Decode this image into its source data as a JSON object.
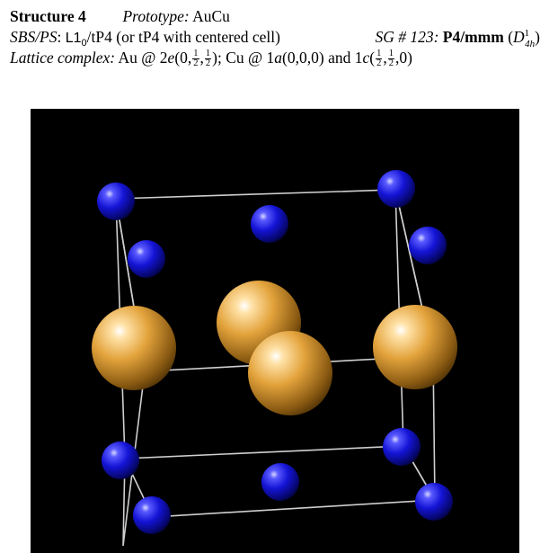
{
  "header": {
    "structure_label": "Structure 4",
    "prototype_label": "Prototype:",
    "prototype_value": "AuCu",
    "sbs_label": "SBS/PS",
    "sbs_value_pre": "L1",
    "sbs_value_sub": "0",
    "sbs_value_post": "/tP4 (or tP4 with centered cell)",
    "sg_label": "SG # 123:",
    "sg_value": "P4/mmm",
    "sg_schoenflies": "D",
    "sg_schoenflies_sup": "1",
    "sg_schoenflies_sub": "4h",
    "lattice_label": "Lattice complex:",
    "au_site_text": "Au @ 2",
    "au_wyckoff": "e",
    "half": "1",
    "two": "2",
    "zero": "0",
    "cu_site_text": "Cu @ 1",
    "cu_wyckoff_a": "a",
    "cu_coords_a": "(0,0,0)",
    "and_text": "and 1",
    "cu_wyckoff_c": "c"
  },
  "figure": {
    "background": "#000000",
    "au_color": "#e3a33c",
    "cu_color": "#1414d6",
    "edge_color": "#cfcfcf",
    "atom_species": [
      "Au",
      "Cu"
    ]
  }
}
